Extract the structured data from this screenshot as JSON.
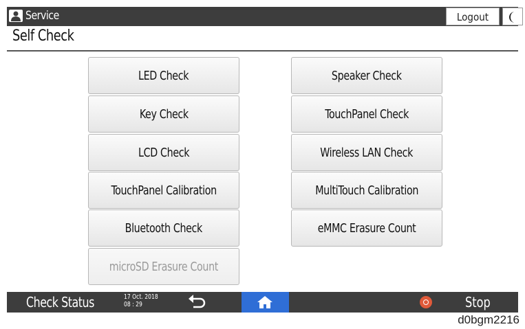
{
  "header": {
    "mode_label": "Service",
    "logout_label": "Logout"
  },
  "page": {
    "title": "Self Check"
  },
  "buttons": {
    "led_check": "LED Check",
    "key_check": "Key Check",
    "lcd_check": "LCD Check",
    "touchpanel_calibration": "TouchPanel Calibration",
    "bluetooth_check": "Bluetooth Check",
    "microsd_erasure_count": "microSD Erasure Count",
    "speaker_check": "Speaker Check",
    "touchpanel_check": "TouchPanel Check",
    "wireless_lan_check": "Wireless LAN Check",
    "multitouch_calibration": "MultiTouch Calibration",
    "emmc_erasure_count": "eMMC Erasure Count"
  },
  "footer": {
    "check_status_label": "Check Status",
    "date": "17 Oct. 2018",
    "time": "08 : 29",
    "stop_label": "Stop"
  },
  "figure_id": "d0bgm2216",
  "icons": [
    "user-icon",
    "moon-icon",
    "back-arrow-icon",
    "home-icon",
    "stop-icon"
  ],
  "colors": {
    "bar": "#3d3d3d",
    "home_accent": "#2f6ed6",
    "stop_accent": "#e05a3a"
  }
}
